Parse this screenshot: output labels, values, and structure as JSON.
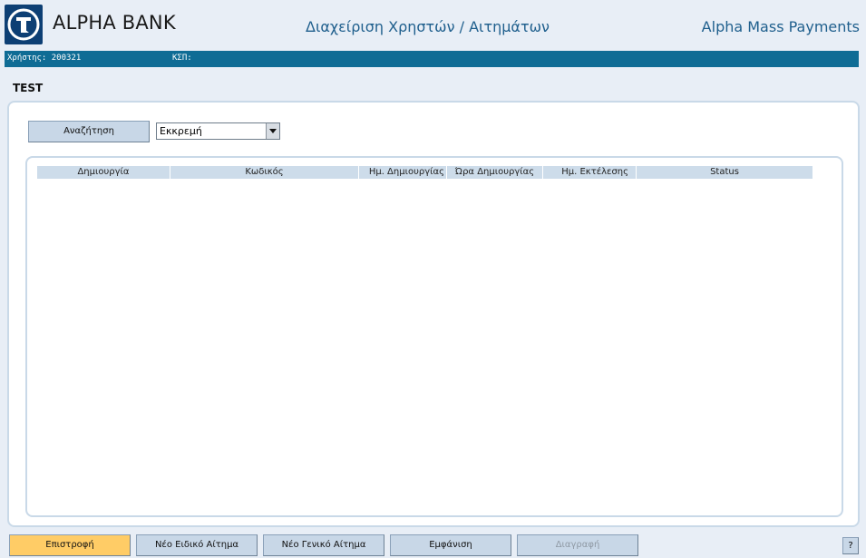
{
  "header": {
    "bank_name": "ALPHA BANK",
    "center_title": "Διαχείριση Χρηστών / Αιτημάτων",
    "app_name": "Alpha Mass Payments"
  },
  "user_bar": {
    "user_label": "Χρήστης: 200321",
    "ksp_label": "ΚΣΠ:"
  },
  "page_title": "TEST",
  "search": {
    "button_label": "Αναζήτηση",
    "status_selected": "Εκκρεμή"
  },
  "grid": {
    "columns": [
      "Δημιουργία",
      "Κωδικός",
      "Ημ. Δημιουργίας",
      "Ώρα Δημιουργίας",
      "Ημ. Εκτέλεσης",
      "Status"
    ],
    "rows": []
  },
  "footer": {
    "back_label": "Επιστροφή",
    "new_special_label": "Νέο Ειδικό Αίτημα",
    "new_general_label": "Νέο Γενικό Αίτημα",
    "view_label": "Εμφάνιση",
    "delete_label": "Διαγραφή",
    "help_label": "?"
  },
  "colors": {
    "brand_blue": "#0d3f74",
    "bar_blue": "#0f6c95",
    "primary_button": "#ffcc66",
    "button_blue": "#c8d7e7"
  }
}
